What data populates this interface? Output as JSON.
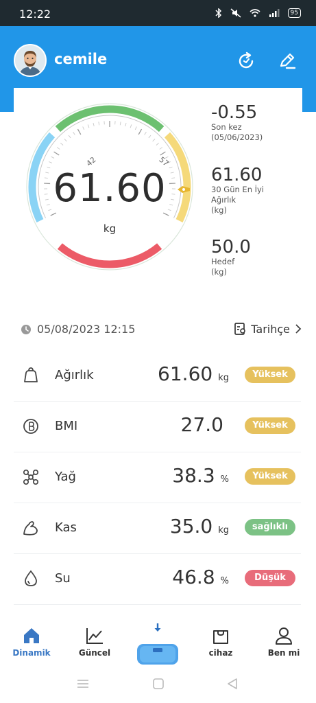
{
  "status_bar": {
    "time": "12:22",
    "battery": "95"
  },
  "header": {
    "username": "cemile"
  },
  "gauge": {
    "value": "61.60",
    "unit": "kg",
    "tick_low": "42",
    "tick_high": "57"
  },
  "stats": [
    {
      "value": "-0.55",
      "label_lines": [
        "Son kez",
        "(05/06/2023)"
      ]
    },
    {
      "value": "61.60",
      "label_lines": [
        "30 Gün En İyi",
        "Ağırlık",
        "(kg)"
      ]
    },
    {
      "value": "50.0",
      "label_lines": [
        "Hedef",
        "(kg)"
      ]
    }
  ],
  "measurement": {
    "datetime": "05/08/2023 12:15",
    "history_label": "Tarihçe"
  },
  "metrics": [
    {
      "icon": "weight-icon",
      "label": "Ağırlık",
      "value": "61.60",
      "unit": "kg",
      "badge": "Yüksek",
      "badge_color": "#e6c15e"
    },
    {
      "icon": "bmi-icon",
      "label": "BMI",
      "value": "27.0",
      "unit": "",
      "badge": "Yüksek",
      "badge_color": "#e6c15e"
    },
    {
      "icon": "fat-icon",
      "label": "Yağ",
      "value": "38.3",
      "unit": "%",
      "badge": "Yüksek",
      "badge_color": "#e6c15e"
    },
    {
      "icon": "muscle-icon",
      "label": "Kas",
      "value": "35.0",
      "unit": "kg",
      "badge": "sağlıklı",
      "badge_color": "#7cc285"
    },
    {
      "icon": "water-icon",
      "label": "Su",
      "value": "46.8",
      "unit": "%",
      "badge": "Düşük",
      "badge_color": "#e86c7a"
    }
  ],
  "nav": [
    {
      "label": "Dinamik",
      "icon": "home-icon",
      "active": true
    },
    {
      "label": "Güncel",
      "icon": "chart-icon",
      "active": false
    },
    {
      "label": "",
      "icon": "scale-icon",
      "active": false
    },
    {
      "label": "cihaz",
      "icon": "bag-icon",
      "active": false
    },
    {
      "label": "Ben mi",
      "icon": "user-icon",
      "active": false
    }
  ],
  "colors": {
    "primary": "#2196e8",
    "green": "#6cc070",
    "yellow": "#f5d97a",
    "red": "#ec5b67",
    "light_blue": "#8ad3f5",
    "nav_active": "#3a78c4"
  }
}
